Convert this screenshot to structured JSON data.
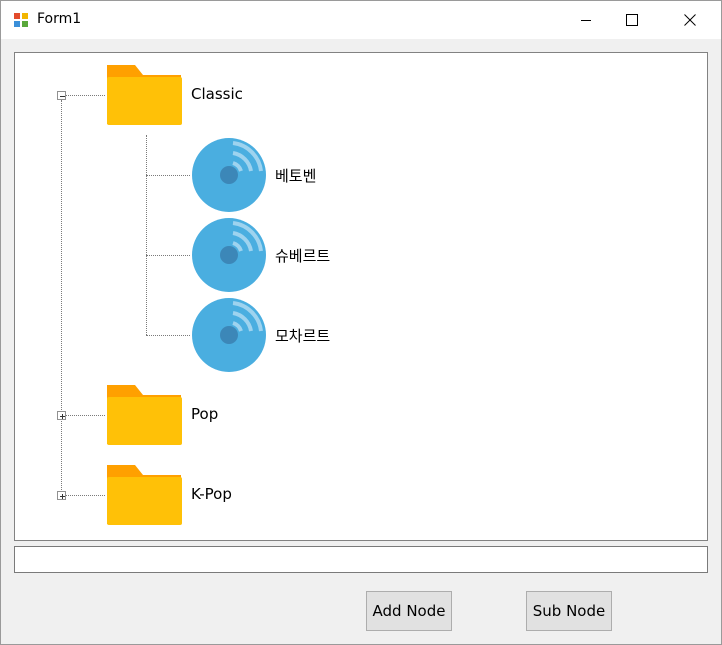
{
  "window": {
    "title": "Form1"
  },
  "tree": {
    "nodes": [
      {
        "label": "Classic",
        "icon": "folder-icon",
        "expander": "minus",
        "children": [
          {
            "label": "베토벤",
            "icon": "cd-disc-icon"
          },
          {
            "label": "슈베르트",
            "icon": "cd-disc-icon"
          },
          {
            "label": "모차르트",
            "icon": "cd-disc-icon"
          }
        ]
      },
      {
        "label": "Pop",
        "icon": "folder-icon",
        "expander": "plus"
      },
      {
        "label": "K-Pop",
        "icon": "folder-icon",
        "expander": "plus"
      }
    ]
  },
  "textbox": {
    "value": ""
  },
  "buttons": {
    "add_node": "Add Node",
    "sub_node": "Sub Node"
  },
  "colors": {
    "folder": "#FFC107",
    "folder_tab": "#FFA000",
    "disc": "#4AAEE0",
    "disc_dark": "#3C87B8"
  }
}
